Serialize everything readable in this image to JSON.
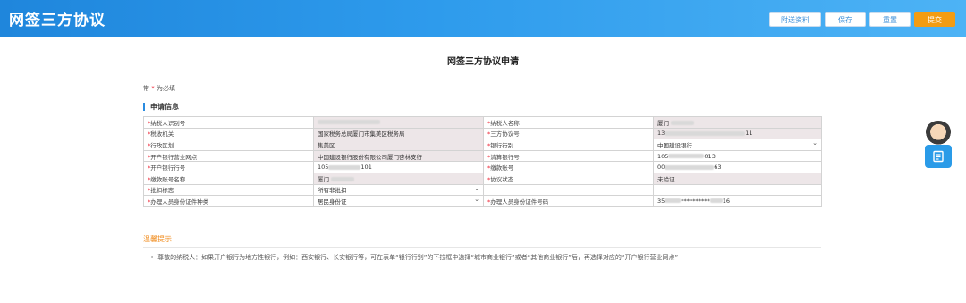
{
  "app": {
    "title": "网签三方协议"
  },
  "toolbar": {
    "attach_label": "附送资料",
    "save_label": "保存",
    "reset_label": "重置",
    "submit_label": "提交"
  },
  "form": {
    "title": "网签三方协议申请",
    "required_note_prefix": "带",
    "required_note_star": "*",
    "required_note_suffix": "为必填",
    "section_title": "申请信息"
  },
  "fields": {
    "taxpayer_id_label": "纳税人识别号",
    "taxpayer_name_label": "纳税人名称",
    "taxpayer_name_value": "厦门",
    "tax_office_label": "税收机关",
    "tax_office_value": "国家税务总局厦门市集美区税务局",
    "agreement_no_label": "三方协议号",
    "agreement_no_prefix": "13",
    "agreement_no_suffix": "11",
    "district_label": "行政区划",
    "district_value": "集美区",
    "bank_category_label": "银行行别",
    "bank_category_value": "中国建设银行",
    "branch_label": "开户银行营业网点",
    "branch_value": "中国建设银行股份有限公司厦门杏林支行",
    "clearing_bank_label": "清算银行号",
    "clearing_bank_prefix": "105",
    "clearing_bank_suffix": "013",
    "bank_code_label": "开户银行行号",
    "bank_code_prefix": "105",
    "bank_code_suffix": "101",
    "account_no_label": "缴款账号",
    "account_no_prefix": "00",
    "account_no_suffix": "63",
    "account_name_label": "缴款账号名称",
    "account_name_value": "厦门",
    "status_label": "协议状态",
    "status_value": "未验证",
    "batch_label": "批扣标志",
    "batch_value": "所有非批扣",
    "id_type_label": "办理人员身份证件种类",
    "id_type_value": "居民身份证",
    "id_no_label": "办理人员身份证件号码",
    "id_no_prefix": "35",
    "id_no_mask": "**********",
    "id_no_suffix": "16"
  },
  "tips": {
    "title": "温馨提示",
    "bullet": "•",
    "text": "尊敬的纳税人：如果开户银行为地方性银行，例如：西安银行、长安银行等，可在表单“银行行别”的下拉框中选择“城市商业银行”或者“其他商业银行”后，再选择对应的“开户银行营业网点”"
  },
  "side": {
    "service_icon": "document-icon",
    "avatar_icon": "assistant-avatar-icon"
  },
  "colors": {
    "header": "#2e9bec",
    "accent": "#f39c12",
    "required": "#e23333"
  }
}
